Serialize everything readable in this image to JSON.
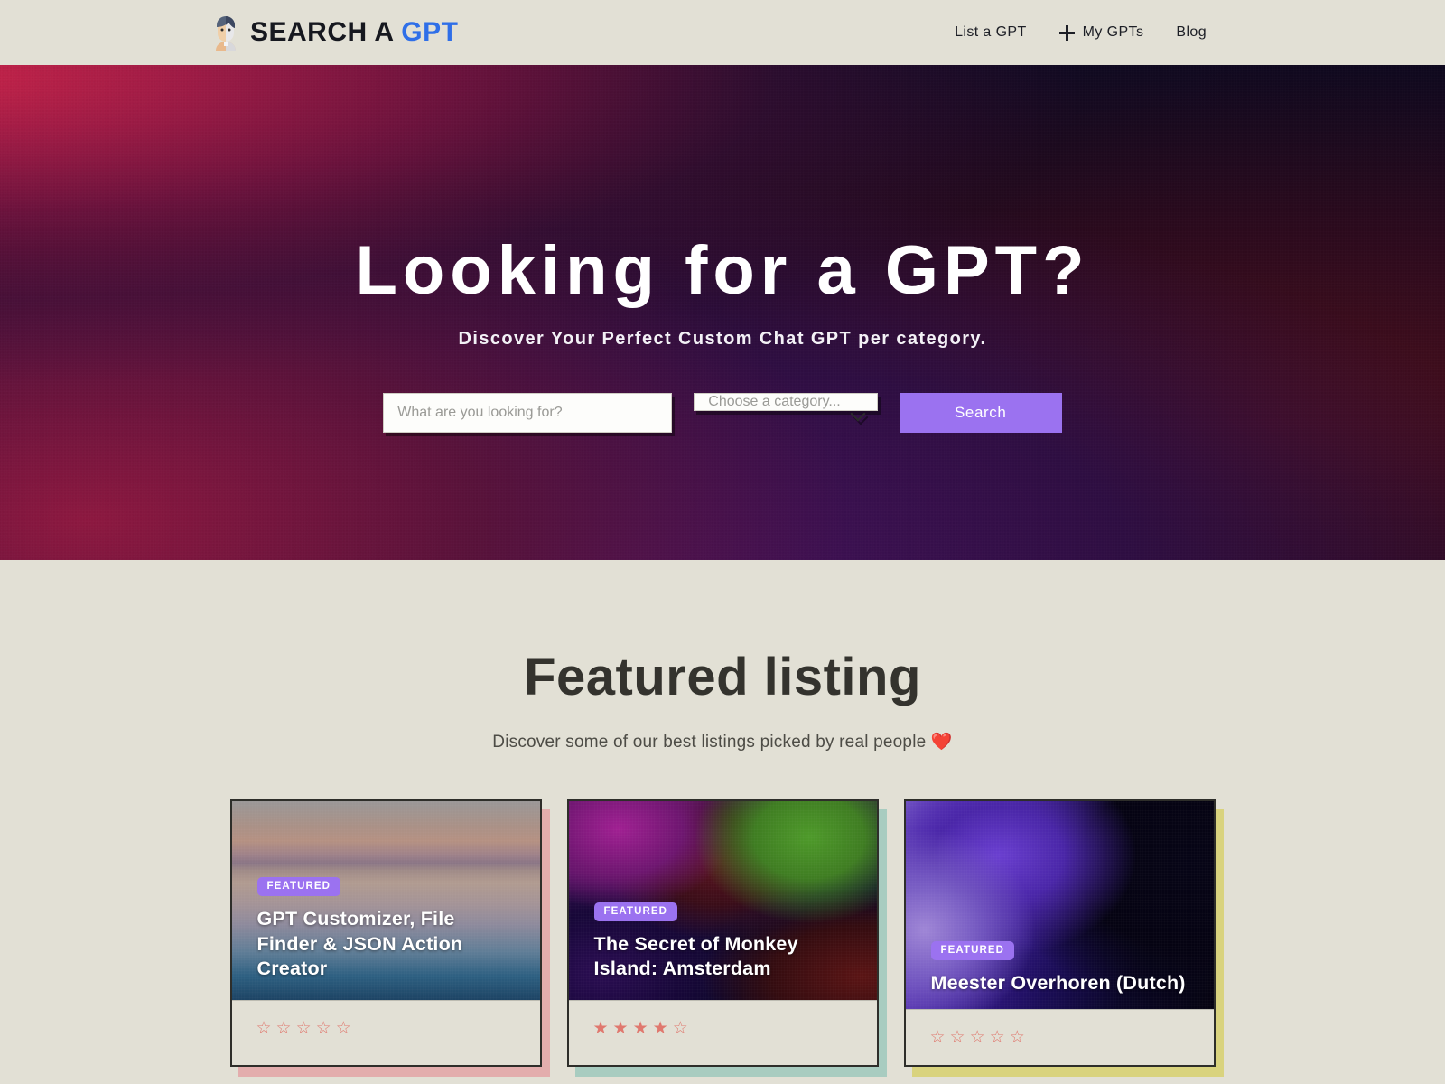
{
  "brand": {
    "icon": "avatar-robot-icon",
    "text_main": "SEARCH A",
    "text_accent": "GPT"
  },
  "nav": {
    "items": [
      {
        "label": "List a GPT",
        "icon": null
      },
      {
        "label": "My GPTs",
        "icon": "plus-icon"
      },
      {
        "label": "Blog",
        "icon": null
      }
    ]
  },
  "hero": {
    "title": "Looking for a GPT?",
    "subtitle": "Discover Your Perfect Custom Chat GPT per category.",
    "search": {
      "query_value": "",
      "query_placeholder": "What are you looking for?",
      "category_selected": "Choose a category...",
      "dropdown_icon": "chevron-down-icon",
      "button_label": "Search",
      "button_color": "#9b72f0"
    }
  },
  "featured": {
    "title": "Featured listing",
    "subtitle": "Discover some of our best listings picked by real people ❤️",
    "badge_label": "FEATURED",
    "badge_color": "#9b72f0",
    "star_color": "#e0786e",
    "cards": [
      {
        "title": "GPT Customizer, File Finder & JSON Action Creator",
        "badge": "FEATURED",
        "rating": 0,
        "max_rating": 5,
        "shadow_color": "#e3adad",
        "media_height": 220
      },
      {
        "title": "The Secret of Monkey Island: Amsterdam",
        "badge": "FEATURED",
        "rating": 4,
        "max_rating": 5,
        "shadow_color": "#a8ccc0",
        "media_height": 220
      },
      {
        "title": "Meester Overhoren (Dutch)",
        "badge": "FEATURED",
        "rating": 0,
        "max_rating": 5,
        "shadow_color": "#d9d37e",
        "media_height": 230
      }
    ]
  },
  "colors": {
    "page_background": "#e2e0d5",
    "text_dark": "#34332e",
    "brand_accent": "#2f6fe8",
    "purple": "#9b72f0"
  }
}
